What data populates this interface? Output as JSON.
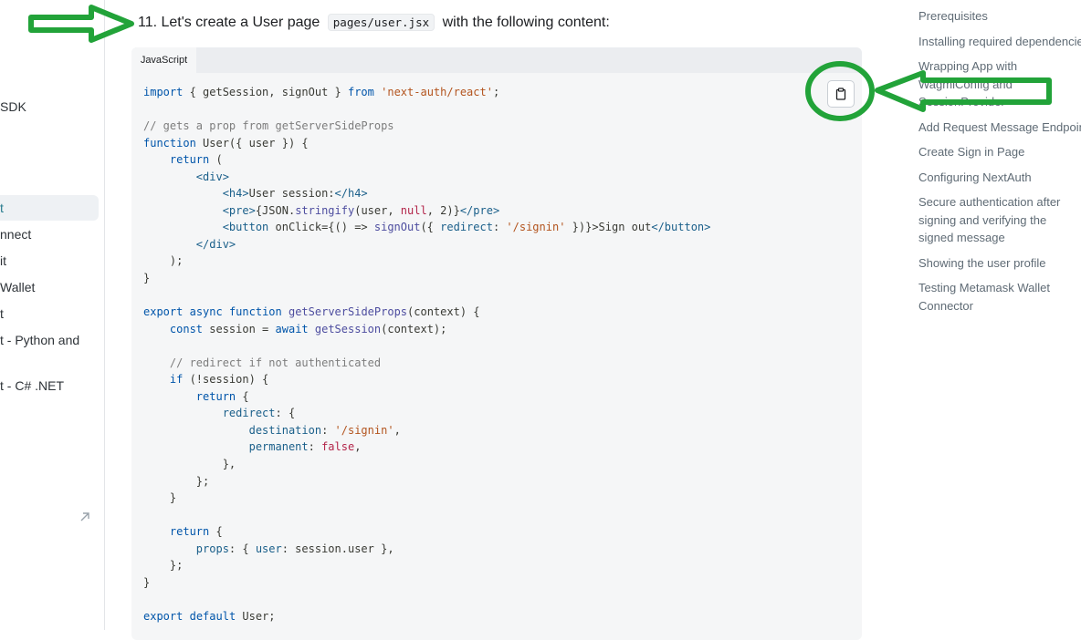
{
  "left_sidebar": {
    "items": [
      {
        "label": "SDK"
      },
      {
        "label": "t"
      },
      {
        "label": "nnect"
      },
      {
        "label": "it"
      },
      {
        "label": "Wallet"
      },
      {
        "label": "t"
      },
      {
        "label": "t - Python and"
      },
      {
        "label": "t - C# .NET"
      }
    ],
    "external_link_icon": "arrow-up-right-icon"
  },
  "step": {
    "text": "11. Let's create a User page",
    "file": "pages/user.jsx",
    "text_after": "with the following content:"
  },
  "code_block": {
    "tab_label": "JavaScript",
    "copy_icon": "clipboard-icon",
    "lines": [
      "import { getSession, signOut } from 'next-auth/react';",
      "",
      "// gets a prop from getServerSideProps",
      "function User({ user }) {",
      "    return (",
      "        <div>",
      "            <h4>User session:</h4>",
      "            <pre>{JSON.stringify(user, null, 2)}</pre>",
      "            <button onClick={() => signOut({ redirect: '/signin' })}>Sign out</button>",
      "        </div>",
      "    );",
      "}",
      "",
      "export async function getServerSideProps(context) {",
      "    const session = await getSession(context);",
      "",
      "    // redirect if not authenticated",
      "    if (!session) {",
      "        return {",
      "            redirect: {",
      "                destination: '/signin',",
      "                permanent: false,",
      "            },",
      "        };",
      "    }",
      "",
      "    return {",
      "        props: { user: session.user },",
      "    };",
      "}",
      "",
      "export default User;"
    ]
  },
  "toc": {
    "items": [
      {
        "label": "Prerequisites"
      },
      {
        "label": "Installing required dependencies"
      },
      {
        "label": "Wrapping App with WagmiConfig and SessionProvider"
      },
      {
        "label": "Add Request Message Endpoint"
      },
      {
        "label": "Create Sign in Page"
      },
      {
        "label": "Configuring NextAuth"
      },
      {
        "label": "Secure authentication after signing and verifying the signed message"
      },
      {
        "label": "Showing the user profile"
      },
      {
        "label": "Testing Metamask Wallet Connector"
      }
    ]
  },
  "annotations": {
    "color": "#22a339"
  }
}
